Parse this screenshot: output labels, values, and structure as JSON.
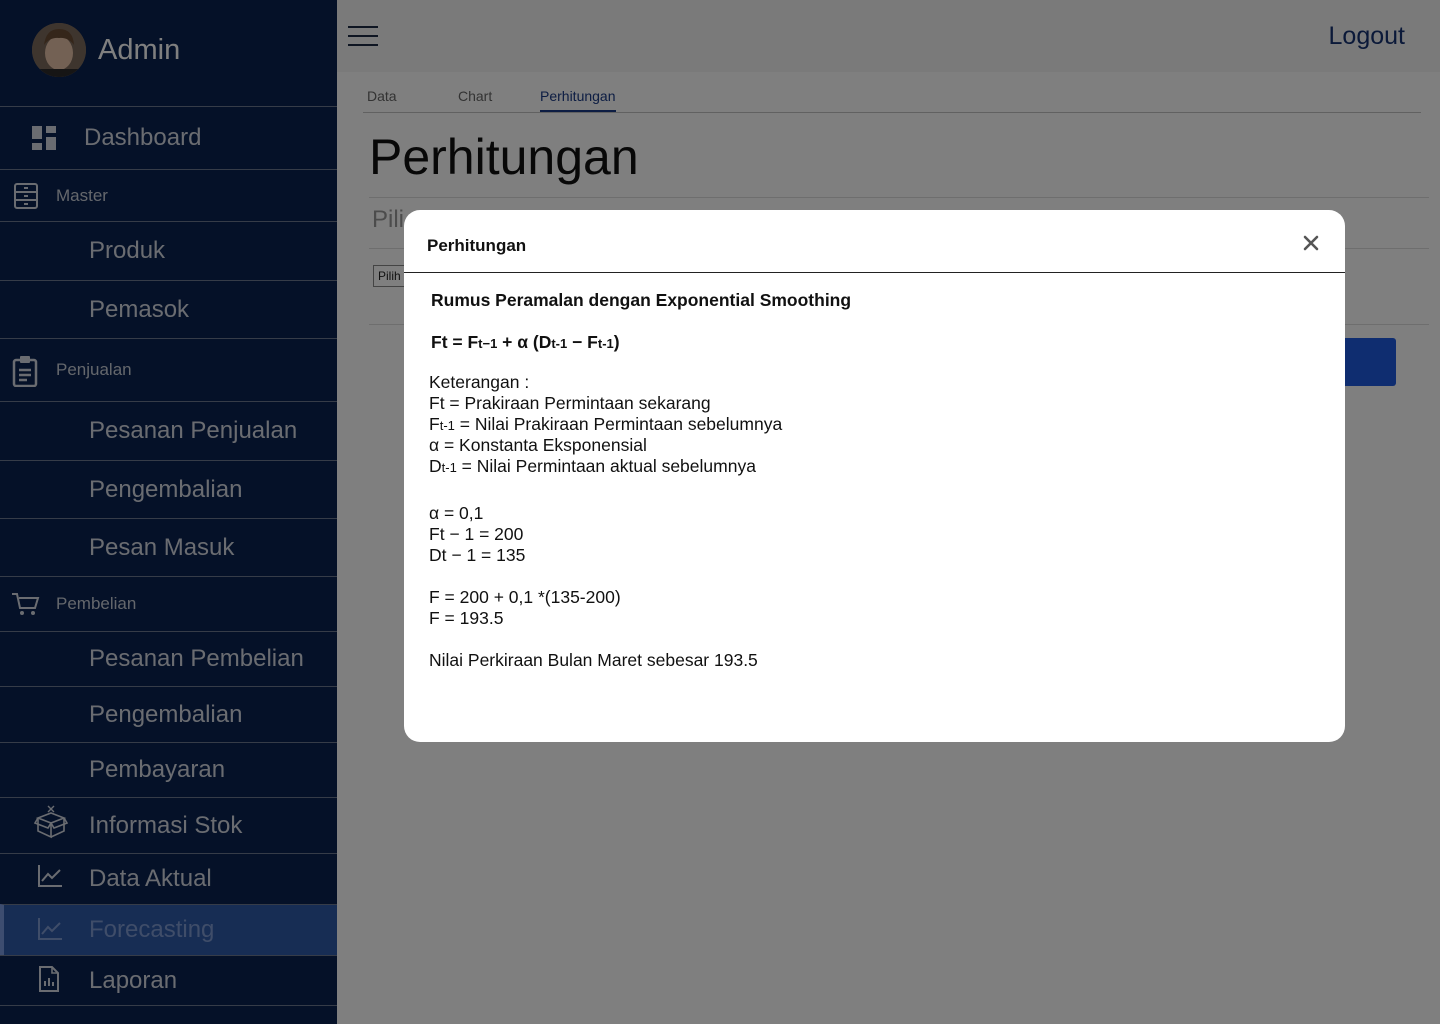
{
  "sidebar": {
    "user_name": "Admin",
    "items": [
      {
        "label": "Dashboard",
        "icon": "dashboard-icon"
      },
      {
        "label": "Master",
        "icon": "drawers-icon"
      },
      {
        "label": "Produk"
      },
      {
        "label": "Pemasok"
      },
      {
        "label": "Penjualan",
        "icon": "clipboard-icon"
      },
      {
        "label": "Pesanan Penjualan"
      },
      {
        "label": "Pengembalian"
      },
      {
        "label": "Pesan Masuk"
      },
      {
        "label": "Pembelian",
        "icon": "cart-icon"
      },
      {
        "label": "Pesanan Pembelian"
      },
      {
        "label": "Pengembalian"
      },
      {
        "label": "Pembayaran"
      },
      {
        "label": "Informasi Stok",
        "icon": "box-icon"
      },
      {
        "label": "Data Aktual",
        "icon": "line-chart-icon"
      },
      {
        "label": "Forecasting",
        "icon": "line-chart-icon",
        "active": true
      },
      {
        "label": "Laporan",
        "icon": "report-icon"
      }
    ]
  },
  "topbar": {
    "logout_label": "Logout"
  },
  "tabs": [
    {
      "label": "Data"
    },
    {
      "label": "Chart"
    },
    {
      "label": "Perhitungan",
      "active": true
    }
  ],
  "page": {
    "title": "Perhitungan",
    "select_title_partial": "Pili",
    "select_value_partial": "Pilih"
  },
  "modal": {
    "title": "Perhitungan",
    "heading": "Rumus Peramalan dengan Exponential Smoothing",
    "formula": {
      "f": "Ft = F",
      "t1": "t−1",
      "mid": " + α (D",
      "t1b": "t-1",
      "minus": " − F",
      "t1c": "t-1",
      "end": ")"
    },
    "keterangan_title": "Keterangan :",
    "ket_ft": "Ft = Prakiraan Permintaan sekarang",
    "ket_ft1_prefix": "F",
    "ket_ft1_sub": "t-1",
    "ket_ft1_rest": " = Nilai Prakiraan Permintaan sebelumnya",
    "ket_alpha": "α = Konstanta Eksponensial",
    "ket_dt1_prefix": "D",
    "ket_dt1_sub": "t-1",
    "ket_dt1_rest": " = Nilai Permintaan aktual sebelumnya",
    "alpha_value": "α = 0,1",
    "ft1_value": "Ft − 1 = 200",
    "dt1_value": "Dt − 1 = 135",
    "calc_line1": "F = 200 + 0,1 *(135-200)",
    "calc_line2": "F = 193.5",
    "conclusion": "Nilai Perkiraan Bulan Maret sebesar 193.5"
  },
  "colors": {
    "sidebar_bg": "#0b2350",
    "active_item": "#2f5aa8",
    "accent": "#1a3a86",
    "button": "#1e5ae0"
  }
}
